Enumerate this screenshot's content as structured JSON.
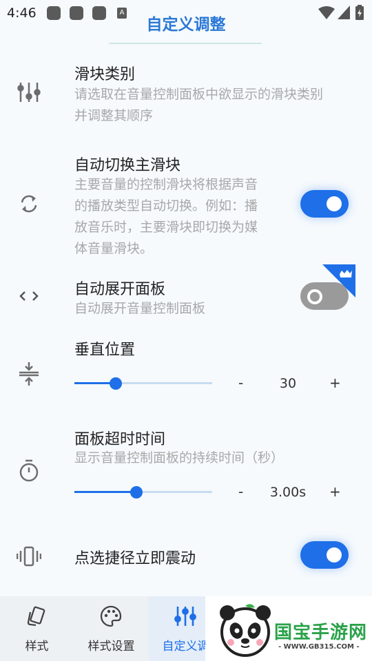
{
  "status_bar": {
    "time": "4:46",
    "notif_letter": "A"
  },
  "header": {
    "title": "自定义调整"
  },
  "rows": {
    "slider_category": {
      "title": "滑块类别",
      "desc_line1": "请选取在音量控制面板中欲显示的滑块类别",
      "desc_line2": "并调整其顺序"
    },
    "auto_switch": {
      "title": "自动切换主滑块",
      "desc_line1": "主要音量的控制滑块将根据声音",
      "desc_line2": "的播放类型自动切换。例如：播",
      "desc_line3": "放音乐时，主要滑块即切换为媒",
      "desc_line4": "体音量滑块。",
      "enabled": true
    },
    "auto_expand": {
      "title": "自动展开面板",
      "desc": "自动展开音量控制面板",
      "enabled": false,
      "premium": true
    },
    "vertical_position": {
      "title": "垂直位置",
      "minus": "-",
      "value": "30",
      "plus": "+",
      "level": 0.3
    },
    "panel_timeout": {
      "title": "面板超时时间",
      "desc": "显示音量控制面板的持续时间（秒）",
      "minus": "-",
      "value": "3.00s",
      "plus": "+",
      "level": 0.45
    },
    "shortcut_vibrate": {
      "title": "点选捷径立即震动",
      "enabled": true
    }
  },
  "nav": {
    "items": [
      {
        "label": "样式",
        "icon": "cards-icon"
      },
      {
        "label": "样式设置",
        "icon": "palette-icon"
      },
      {
        "label": "自定义调",
        "icon": "sliders-icon"
      }
    ]
  },
  "watermark": {
    "brand": "国宝手游网",
    "url": "- WWW.GB315.COM -"
  },
  "colors": {
    "accent": "#1e6fe8",
    "title": "#2a78d6",
    "premium": "#1e6fe8"
  }
}
